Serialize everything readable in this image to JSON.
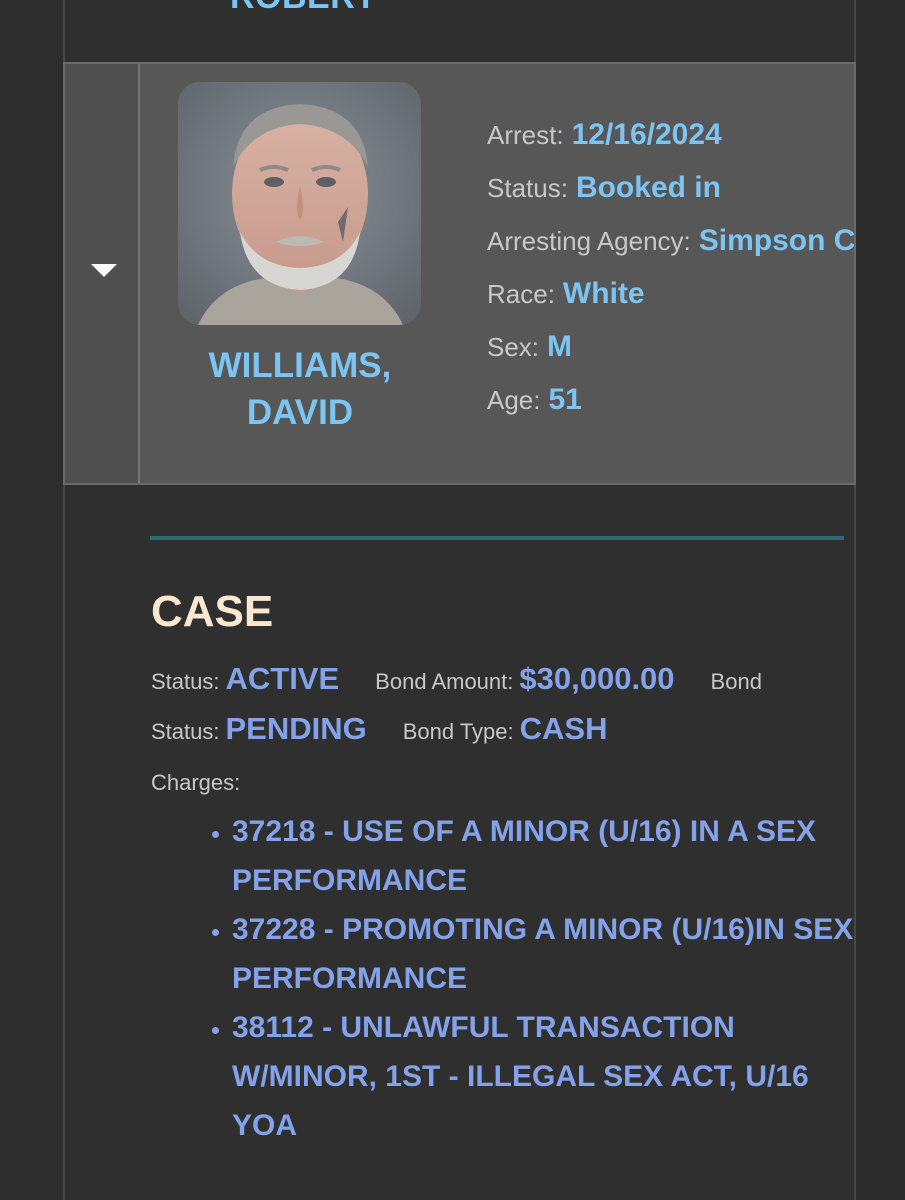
{
  "previous_record": {
    "name_fragment": "ROBERT"
  },
  "record": {
    "name_line1": "WILLIAMS,",
    "name_line2": "DAVID",
    "details": [
      {
        "label": "Arrest:",
        "value": "12/16/2024"
      },
      {
        "label": "Status:",
        "value": "Booked in"
      },
      {
        "label": "Arresting Agency:",
        "value": "Simpson C"
      },
      {
        "label": "Race:",
        "value": "White"
      },
      {
        "label": "Sex:",
        "value": "M"
      },
      {
        "label": "Age:",
        "value": "51"
      }
    ]
  },
  "case": {
    "title": "CASE",
    "status_label": "Status:",
    "status_value": "ACTIVE",
    "bond_amount_label": "Bond Amount:",
    "bond_amount_value": "$30,000.00",
    "bond_status_label_a": "Bond",
    "bond_status_label_b": "Status:",
    "bond_status_value": "PENDING",
    "bond_type_label": "Bond Type:",
    "bond_type_value": "CASH",
    "charges_label": "Charges:",
    "charges": [
      "37218 - USE OF A MINOR (U/16) IN A SEX PERFORMANCE",
      "37228 - PROMOTING A MINOR (U/16)IN SEX PERFORMANCE",
      "38112 - UNLAWFUL TRANSACTION W/MINOR, 1ST - ILLEGAL SEX ACT, U/16 YOA"
    ]
  },
  "colors": {
    "value_blue": "#7cc4f2",
    "case_blue": "#84a2ea",
    "case_title": "#fbe7cf",
    "divider": "#2c6b70",
    "card_bg": "#575757"
  }
}
